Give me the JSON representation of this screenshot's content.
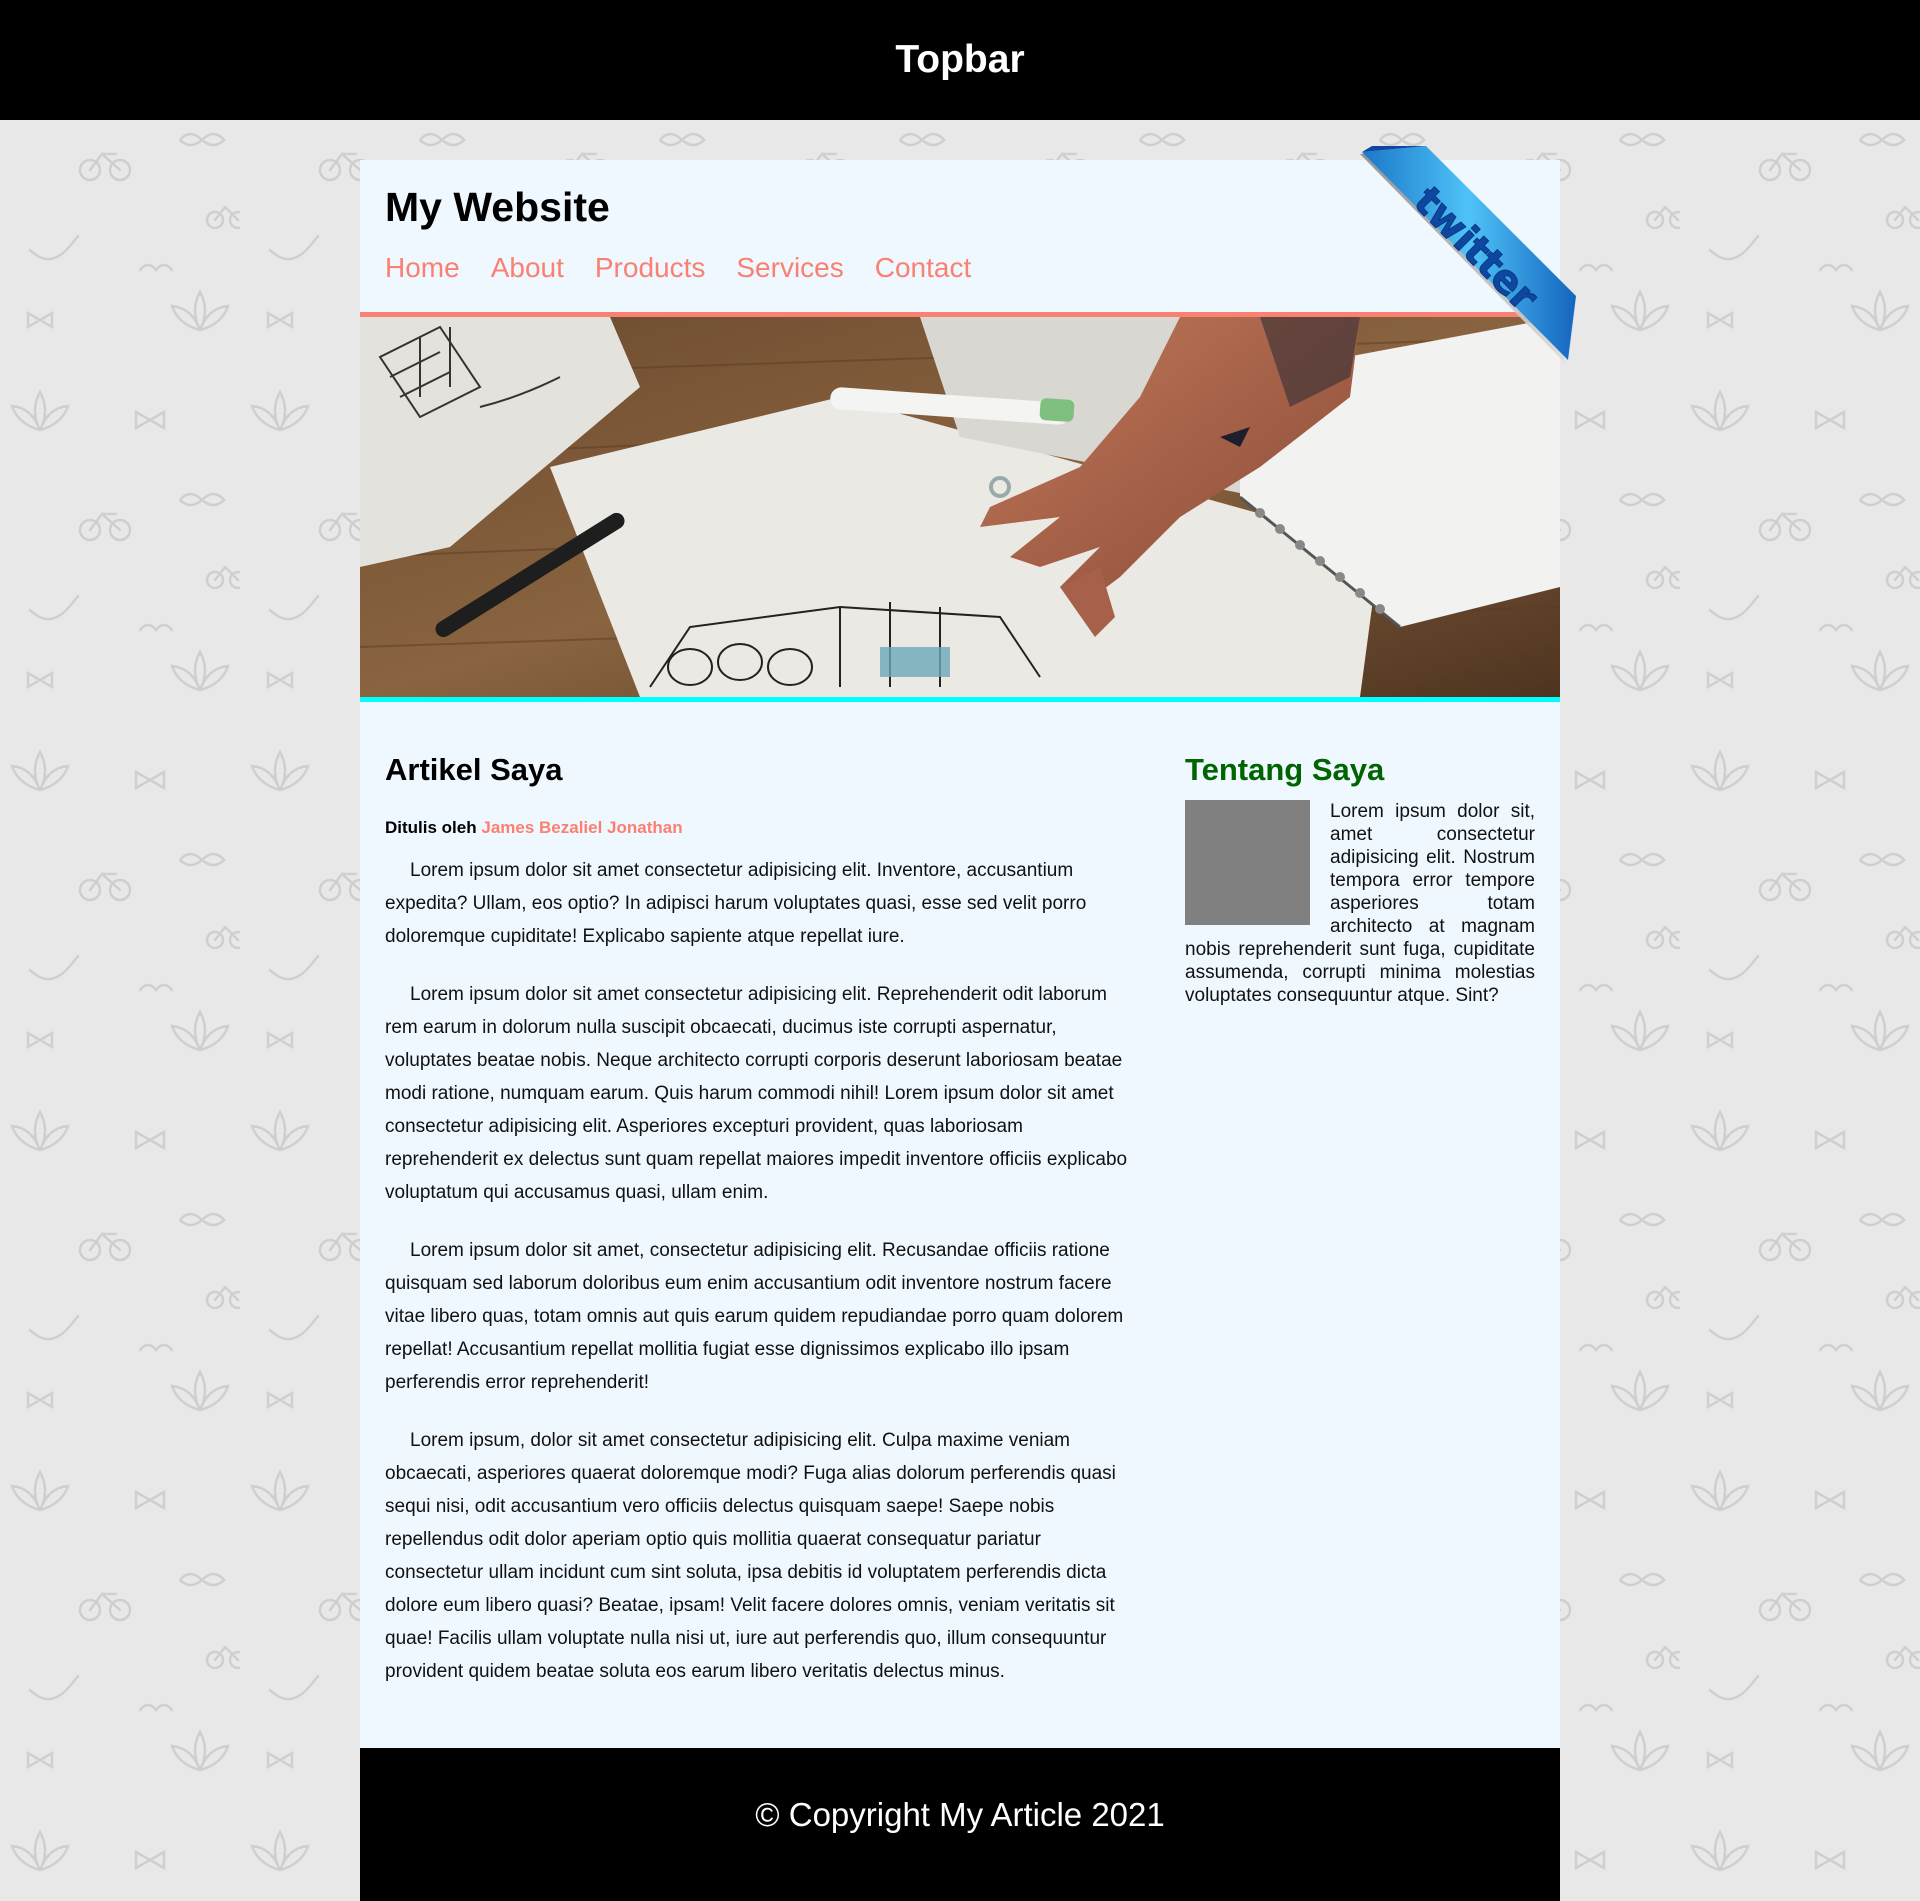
{
  "topbar": {
    "title": "Topbar"
  },
  "header": {
    "site_title": "My Website",
    "nav": [
      "Home",
      "About",
      "Products",
      "Services",
      "Contact"
    ]
  },
  "ribbon": {
    "label": "twitter"
  },
  "hero": {
    "image": "hand-sketching-architecture-drawing-photo"
  },
  "article": {
    "heading": "Artikel Saya",
    "byline_prefix": "Ditulis oleh",
    "author": "James Bezaliel Jonathan",
    "paragraphs": [
      "Lorem ipsum dolor sit amet consectetur adipisicing elit. Inventore, accusantium expedita? Ullam, eos optio? In adipisci harum voluptates quasi, esse sed velit porro doloremque cupiditate! Explicabo sapiente atque repellat iure.",
      "Lorem ipsum dolor sit amet consectetur adipisicing elit. Reprehenderit odit laborum rem earum in dolorum nulla suscipit obcaecati, ducimus iste corrupti aspernatur, voluptates beatae nobis. Neque architecto corrupti corporis deserunt laboriosam beatae modi ratione, numquam earum. Quis harum commodi nihil! Lorem ipsum dolor sit amet consectetur adipisicing elit. Asperiores excepturi provident, quas laboriosam reprehenderit ex delectus sunt quam repellat maiores impedit inventore officiis explicabo voluptatum qui accusamus quasi, ullam enim.",
      "Lorem ipsum dolor sit amet, consectetur adipisicing elit. Recusandae officiis ratione quisquam sed laborum doloribus eum enim accusantium odit inventore nostrum facere vitae libero quas, totam omnis aut quis earum quidem repudiandae porro quam dolorem repellat! Accusantium repellat mollitia fugiat esse dignissimos explicabo illo ipsam perferendis error reprehenderit!",
      "Lorem ipsum, dolor sit amet consectetur adipisicing elit. Culpa maxime veniam obcaecati, asperiores quaerat doloremque modi? Fuga alias dolorum perferendis quasi sequi nisi, odit accusantium vero officiis delectus quisquam saepe! Saepe nobis repellendus odit dolor aperiam optio quis mollitia quaerat consequatur pariatur consectetur ullam incidunt cum sint soluta, ipsa debitis id voluptatem perferendis dicta dolore eum libero quasi? Beatae, ipsam! Velit facere dolores omnis, veniam veritatis sit quae! Facilis ullam voluptate nulla nisi ut, iure aut perferendis quo, illum consequuntur provident quidem beatae soluta eos earum libero veritatis delectus minus."
    ]
  },
  "aside": {
    "heading": "Tentang Saya",
    "text": "Lorem ipsum dolor sit, amet consectetur adipisicing elit. Nostrum tempora error tempore asperiores totam architecto at magnam nobis reprehenderit sunt fuga, cupiditate assumenda, corrupti minima molestias voluptates consequuntur atque. Sint?"
  },
  "footer": {
    "text": "© Copyright My Article 2021"
  },
  "colors": {
    "nav_link": "#fa8072",
    "aside_heading": "#006400",
    "hero_top_border": "#fa8072",
    "hero_bottom_border": "#00ffff",
    "container_bg": "#f0f8ff",
    "page_bg": "#e8e8e8"
  }
}
